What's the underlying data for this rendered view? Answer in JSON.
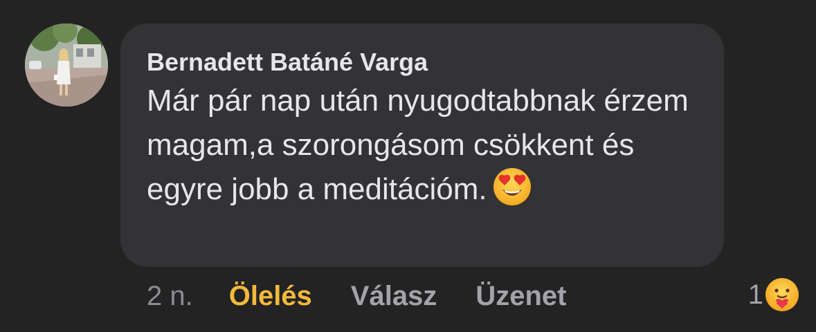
{
  "comment": {
    "author": "Bernadett Batáné Varga",
    "text": "Már pár nap után nyugodtabbnak érzem magam,a szorongásom csökkent és egyre jobb a meditációm.",
    "text_emoji": "heart-eyes-emoji",
    "avatar": "profile-photo"
  },
  "actions": {
    "time": "2 n.",
    "hug_label": "Ölelés",
    "reply_label": "Válasz",
    "message_label": "Üzenet"
  },
  "reactions": {
    "count": "1",
    "icon": "care-reaction-icon"
  },
  "colors": {
    "background": "#232324",
    "bubble": "#333335",
    "text": "#e6e7eb",
    "muted": "#a3a4a9",
    "accent": "#f2b93b"
  }
}
